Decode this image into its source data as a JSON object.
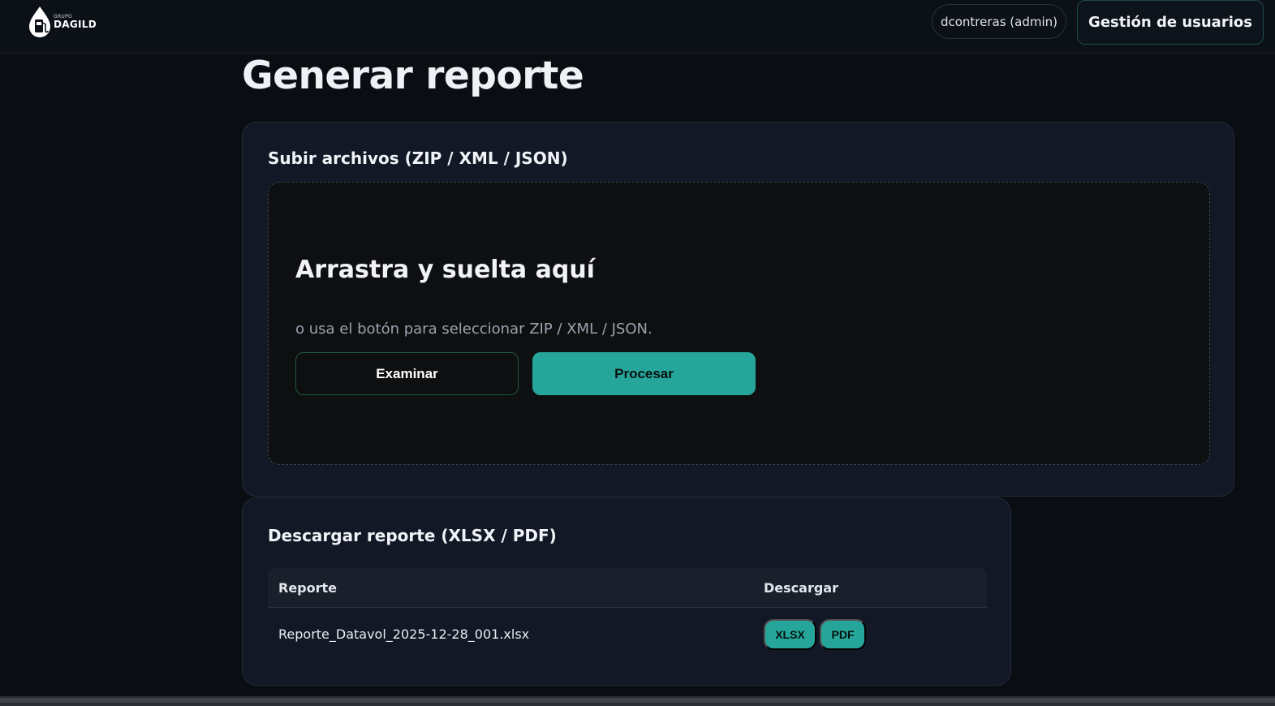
{
  "header": {
    "logo": {
      "small_text": "GRUPO",
      "big_text": "DAGILD",
      "icon": "fuel-drop-icon"
    },
    "user_label": "dcontreras (admin)",
    "admin_button": "Gestión de usuarios"
  },
  "page": {
    "title": "Generar reporte"
  },
  "upload": {
    "title": "Subir archivos (ZIP / XML / JSON)",
    "dropzone": {
      "title": "Arrastra y suelta aquí",
      "subtitle": "o usa el botón para seleccionar ZIP / XML / JSON."
    },
    "browse_label": "Examinar",
    "process_label": "Procesar"
  },
  "download": {
    "title": "Descargar reporte (XLSX / PDF)",
    "columns": [
      "Reporte",
      "Descargar"
    ],
    "rows": [
      {
        "name": "Reporte_Datavol_2025-12-28_001.xlsx",
        "actions": [
          "XLSX",
          "PDF"
        ]
      }
    ]
  },
  "colors": {
    "accent": "#26a69a",
    "background": "#0a0d12",
    "card": "#121826"
  }
}
